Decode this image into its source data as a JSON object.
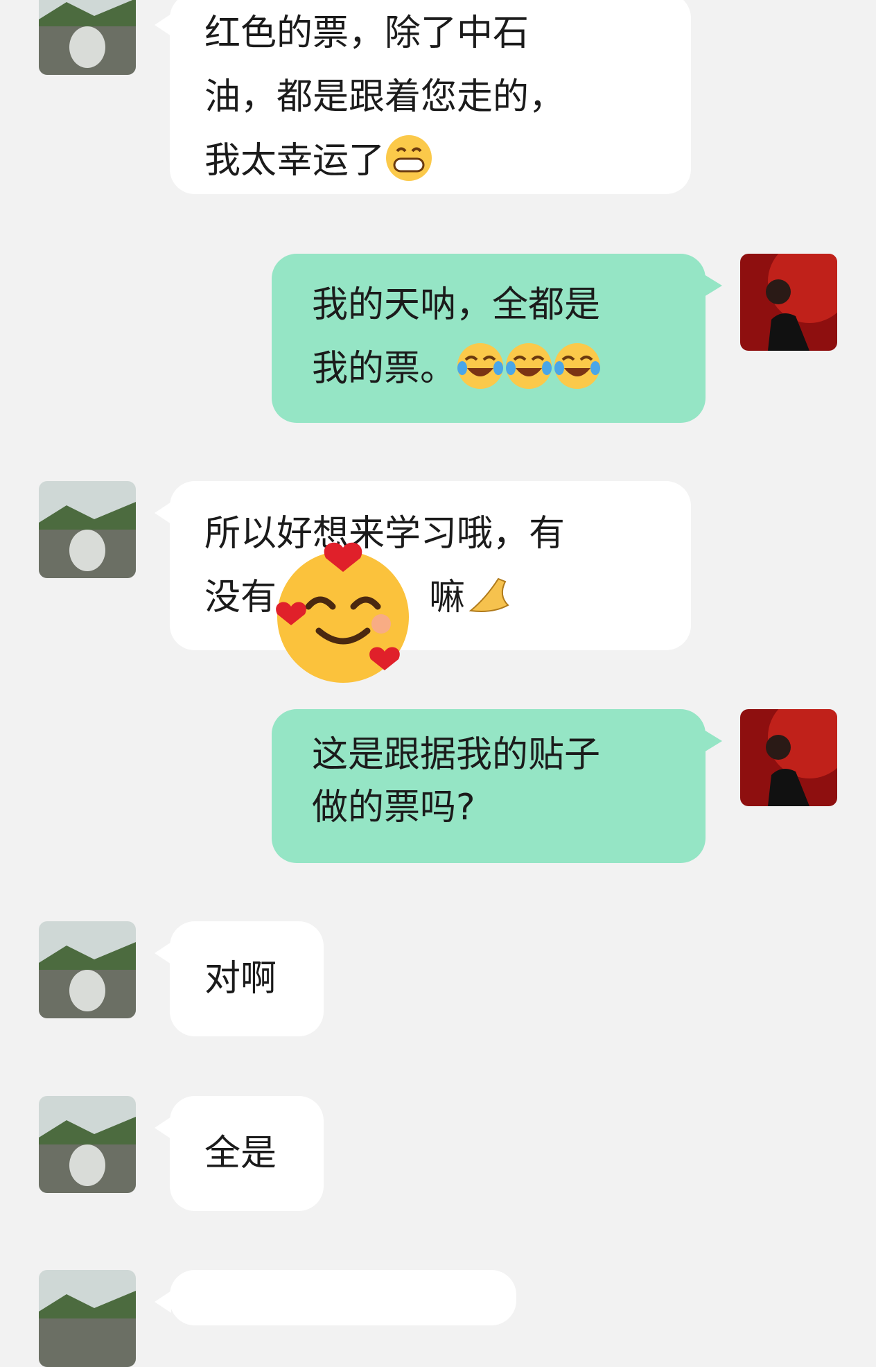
{
  "messages": [
    {
      "side": "left",
      "lines": [
        "红色的票，除了中石",
        "油，都是跟着您走的，",
        "我太幸运了"
      ],
      "emoji": "grinning-emoji"
    },
    {
      "side": "right",
      "lines": [
        "我的天呐，全都是",
        "我的票。"
      ],
      "emoji": "tears-of-joy-emoji-x3"
    },
    {
      "side": "left",
      "lines": [
        "所以好想来学习哦，有",
        "没有",
        "嘛"
      ],
      "emoji": "pinched-fingers-emoji"
    },
    {
      "side": "right",
      "lines": [
        "这是跟据我的贴子",
        "做的票吗?"
      ]
    },
    {
      "side": "left",
      "lines": [
        "对啊"
      ]
    },
    {
      "side": "left",
      "lines": [
        "全是"
      ]
    }
  ],
  "overlay_emoji": "smiling-face-with-hearts-emoji",
  "colors": {
    "background": "#f2f2f2",
    "incoming": "#ffffff",
    "outgoing": "#95e5c5"
  }
}
